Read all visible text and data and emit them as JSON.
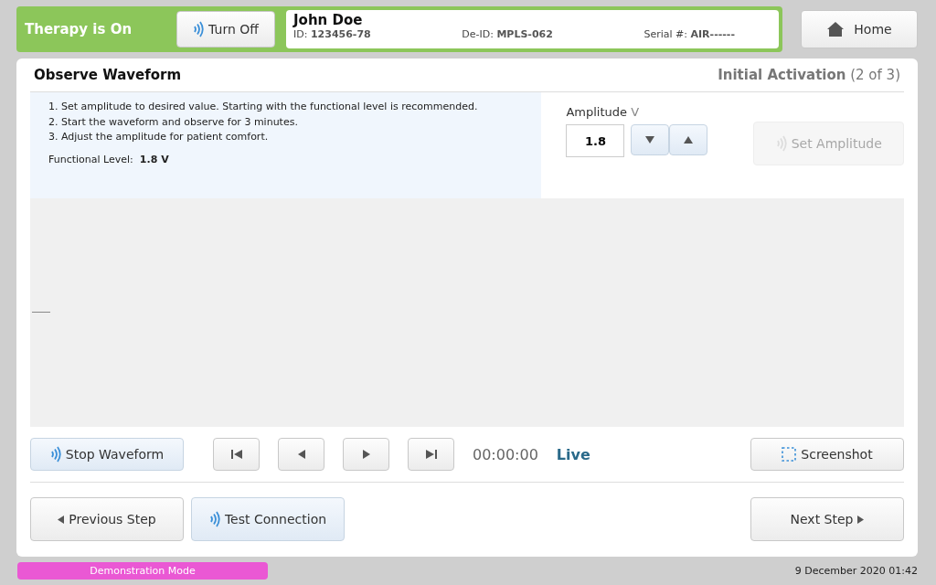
{
  "therapy": {
    "label": "Therapy is On",
    "on": true,
    "toggle_button": "Turn Off"
  },
  "patient": {
    "name": "John Doe",
    "fields": [
      {
        "label": "ID:",
        "value": "123456-78"
      },
      {
        "label": "De-ID:",
        "value": "MPLS-062"
      },
      {
        "label": "Serial #:",
        "value": "AIR------"
      }
    ]
  },
  "home_button": "Home",
  "panel": {
    "title": "Observe Waveform",
    "stage": "Initial Activation",
    "step": "(2 of 3)"
  },
  "instructions": [
    "1. Set amplitude to desired value. Starting with the functional level is recommended.",
    "2. Start the waveform and observe for 3 minutes.",
    "3. Adjust the amplitude for patient comfort."
  ],
  "functional_level": {
    "label": "Functional Level:",
    "value": "1.8 V"
  },
  "amplitude": {
    "label": "Amplitude",
    "unit": "V",
    "value": "1.8",
    "set_button": {
      "label": "Set Amplitude",
      "disabled": true
    }
  },
  "playback": {
    "stop_button": "Stop Waveform",
    "time": "00:00:00",
    "mode": "Live",
    "screenshot_button": "Screenshot"
  },
  "navigation": {
    "previous": "Previous Step",
    "test": "Test Connection",
    "next": "Next Step"
  },
  "footer": {
    "mode": "Demonstration Mode",
    "datetime": "9 December 2020 01:42"
  }
}
